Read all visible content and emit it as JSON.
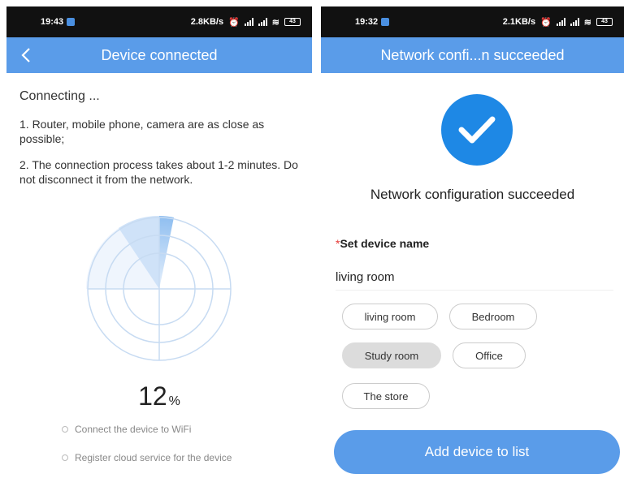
{
  "left": {
    "status": {
      "time": "19:43",
      "speed": "2.8KB/s",
      "battery": "43"
    },
    "header": {
      "title": "Device connected",
      "back_icon": "chevron-left-icon"
    },
    "connecting": "Connecting ...",
    "tips": [
      "1. Router, mobile phone, camera are as close as possible;",
      "2. The connection process takes about 1-2 minutes. Do not disconnect it from the network."
    ],
    "progress": {
      "value": "12",
      "unit": "%"
    },
    "steps": [
      "Connect the device to WiFi",
      "Register cloud service for the device"
    ],
    "accent": "#5a9ce9"
  },
  "right": {
    "status": {
      "time": "19:32",
      "speed": "2.1KB/s",
      "battery": "43"
    },
    "header": {
      "title": "Network confi...n succeeded"
    },
    "success_text": "Network configuration succeeded",
    "name_label": {
      "required_mark": "*",
      "text": "Set device name"
    },
    "name_value": "living room",
    "chips": [
      {
        "label": "living room",
        "selected": false
      },
      {
        "label": "Bedroom",
        "selected": false
      },
      {
        "label": "Study room",
        "selected": true
      },
      {
        "label": "Office",
        "selected": false
      },
      {
        "label": "The store",
        "selected": false
      }
    ],
    "add_button": "Add device to list",
    "accent": "#1e88e5"
  }
}
